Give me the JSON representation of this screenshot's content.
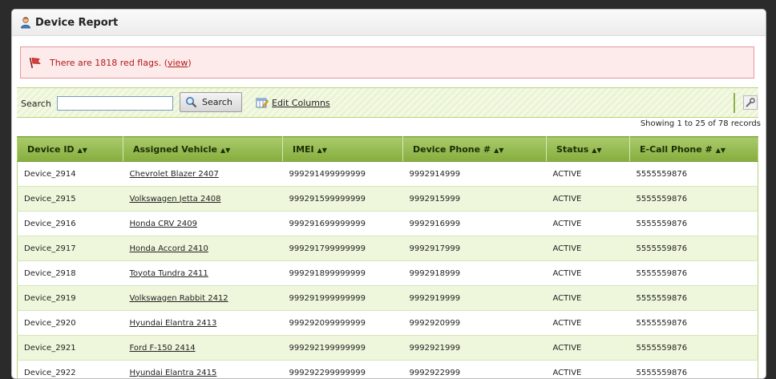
{
  "header": {
    "title": "Device Report",
    "icon": "user-icon"
  },
  "alert": {
    "message": "There are 1818 red flags.",
    "paren_open": "(",
    "link": "view",
    "paren_close": ")",
    "color": "#b11b1b"
  },
  "toolbar": {
    "search_label": "Search",
    "search_value": "",
    "search_button": "Search",
    "edit_columns": "Edit Columns"
  },
  "records_text": "Showing 1 to 25 of 78 records",
  "table": {
    "columns": [
      "Device ID",
      "Assigned Vehicle",
      "IMEI",
      "Device Phone #",
      "Status",
      "E-Call Phone #"
    ],
    "rows": [
      [
        "Device_2914",
        "Chevrolet Blazer 2407",
        "999291499999999",
        "9992914999",
        "ACTIVE",
        "5555559876"
      ],
      [
        "Device_2915",
        "Volkswagen  Jetta 2408",
        "999291599999999",
        "9992915999",
        "ACTIVE",
        "5555559876"
      ],
      [
        "Device_2916",
        "Honda CRV 2409",
        "999291699999999",
        "9992916999",
        "ACTIVE",
        "5555559876"
      ],
      [
        "Device_2917",
        "Honda Accord 2410",
        "999291799999999",
        "9992917999",
        "ACTIVE",
        "5555559876"
      ],
      [
        "Device_2918",
        "Toyota Tundra 2411",
        "999291899999999",
        "9992918999",
        "ACTIVE",
        "5555559876"
      ],
      [
        "Device_2919",
        "Volkswagen  Rabbit 2412",
        "999291999999999",
        "9992919999",
        "ACTIVE",
        "5555559876"
      ],
      [
        "Device_2920",
        "Hyundai Elantra 2413",
        "999292099999999",
        "9992920999",
        "ACTIVE",
        "5555559876"
      ],
      [
        "Device_2921",
        "Ford F-150 2414",
        "999292199999999",
        "9992921999",
        "ACTIVE",
        "5555559876"
      ],
      [
        "Device_2922",
        "Hyundai Elantra 2415",
        "999292299999999",
        "9992922999",
        "ACTIVE",
        "5555559876"
      ]
    ]
  }
}
